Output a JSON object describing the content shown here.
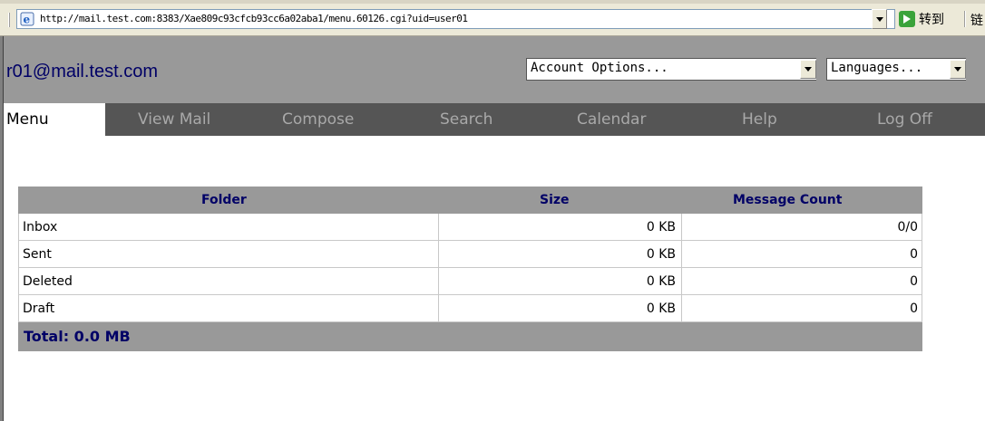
{
  "browser": {
    "url": "http://mail.test.com:8383/Xae809c93cfcb93cc6a02aba1/menu.60126.cgi?uid=user01",
    "go_label": "转到",
    "links_label": "链"
  },
  "header": {
    "email": "r01@mail.test.com",
    "account_options": "Account Options...",
    "languages": "Languages..."
  },
  "nav": {
    "items": [
      "Menu",
      "View Mail",
      "Compose",
      "Search",
      "Calendar",
      "Help",
      "Log Off"
    ],
    "active": "Menu"
  },
  "table": {
    "headers": [
      "Folder",
      "Size",
      "Message Count"
    ],
    "rows": [
      {
        "folder": "Inbox",
        "size": "0 KB",
        "count": "0/0"
      },
      {
        "folder": "Sent",
        "size": "0 KB",
        "count": "0"
      },
      {
        "folder": "Deleted",
        "size": "0 KB",
        "count": "0"
      },
      {
        "folder": "Draft",
        "size": "0 KB",
        "count": "0"
      }
    ],
    "total": "Total: 0.0 MB"
  },
  "colors": {
    "header_bg": "#999999",
    "nav_bg": "#555555",
    "nav_text": "#a9a9a9",
    "accent_text": "#000066"
  }
}
